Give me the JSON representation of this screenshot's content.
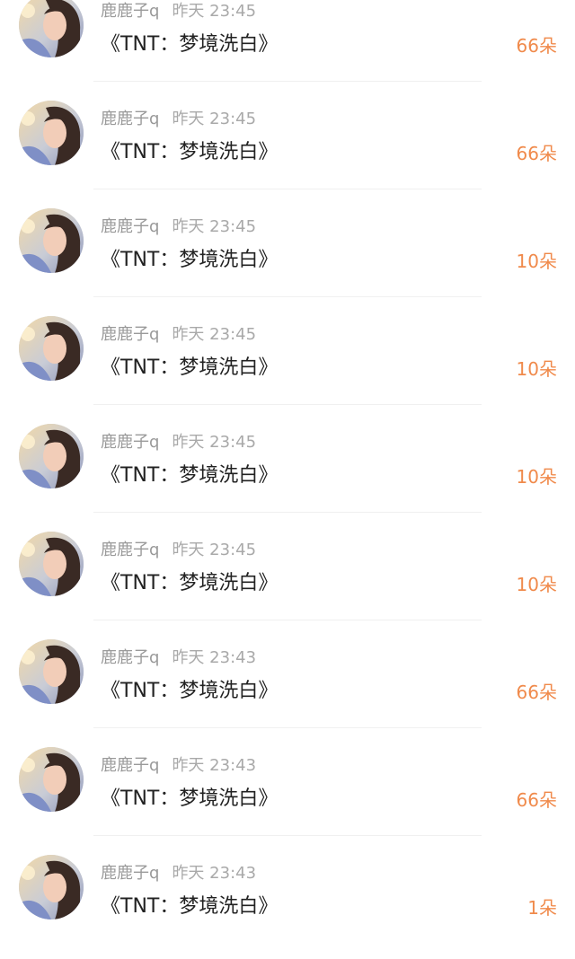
{
  "accent_color": "#f08a4b",
  "avatar_icon": "user-photo-avatar",
  "gifts": [
    {
      "username": "鹿鹿子q",
      "time": "昨天 23:45",
      "message": "《TNT：梦境洗白》",
      "amount": "66朵"
    },
    {
      "username": "鹿鹿子q",
      "time": "昨天 23:45",
      "message": "《TNT：梦境洗白》",
      "amount": "66朵"
    },
    {
      "username": "鹿鹿子q",
      "time": "昨天 23:45",
      "message": "《TNT：梦境洗白》",
      "amount": "10朵"
    },
    {
      "username": "鹿鹿子q",
      "time": "昨天 23:45",
      "message": "《TNT：梦境洗白》",
      "amount": "10朵"
    },
    {
      "username": "鹿鹿子q",
      "time": "昨天 23:45",
      "message": "《TNT：梦境洗白》",
      "amount": "10朵"
    },
    {
      "username": "鹿鹿子q",
      "time": "昨天 23:45",
      "message": "《TNT：梦境洗白》",
      "amount": "10朵"
    },
    {
      "username": "鹿鹿子q",
      "time": "昨天 23:43",
      "message": "《TNT：梦境洗白》",
      "amount": "66朵"
    },
    {
      "username": "鹿鹿子q",
      "time": "昨天 23:43",
      "message": "《TNT：梦境洗白》",
      "amount": "66朵"
    },
    {
      "username": "鹿鹿子q",
      "time": "昨天 23:43",
      "message": "《TNT：梦境洗白》",
      "amount": "1朵"
    }
  ]
}
